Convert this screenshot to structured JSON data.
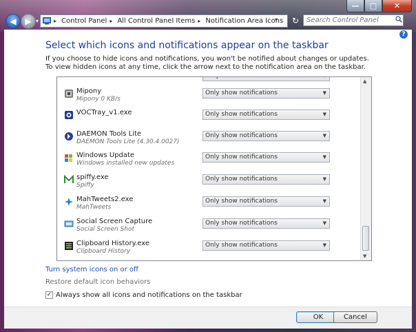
{
  "window": {
    "caption": {
      "minimize": "—",
      "maximize": "□",
      "close": "✕"
    }
  },
  "navigation": {
    "back_glyph": "◀",
    "forward_glyph": "▶",
    "history_dropdown": "▾",
    "breadcrumb": [
      "Control Panel",
      "All Control Panel Items",
      "Notification Area Icons"
    ],
    "breadcrumb_separator": "▸",
    "address_dropdown": "▾",
    "refresh_glyph": "↻",
    "search_placeholder": "Search Control Panel"
  },
  "help_glyph": "?",
  "heading": "Select which icons and notifications appear on the taskbar",
  "description": "If you choose to hide icons and notifications, you won't be notified about changes or updates. To view hidden icons at any time, click the arrow next to the notification area on the taskbar.",
  "icons": [
    {
      "name": "Mipony",
      "subtitle": "Mipony 0 KB/s",
      "behavior": "Only show notifications",
      "icon": "mipony-icon"
    },
    {
      "name": "VOCTray_v1.exe",
      "subtitle": "",
      "behavior": "Only show notifications",
      "icon": "voctray-icon"
    },
    {
      "name": "DAEMON Tools Lite",
      "subtitle": "DAEMON Tools Lite (4.30.4.0027)",
      "behavior": "Only show notifications",
      "icon": "daemon-tools-icon"
    },
    {
      "name": "Windows Update",
      "subtitle": "Windows installed new updates",
      "behavior": "Only show notifications",
      "icon": "windows-update-icon"
    },
    {
      "name": "spiffy.exe",
      "subtitle": "Spiffy",
      "behavior": "Only show notifications",
      "icon": "spiffy-icon"
    },
    {
      "name": "MahTweets2.exe",
      "subtitle": "MahTweets",
      "behavior": "Only show notifications",
      "icon": "mahtweets-icon"
    },
    {
      "name": "Social Screen Capture",
      "subtitle": "Social Screen Shot",
      "behavior": "Only show notifications",
      "icon": "social-screen-capture-icon"
    },
    {
      "name": "Clipboard History.exe",
      "subtitle": "Clipboard History",
      "behavior": "Only show notifications",
      "icon": "clipboard-history-icon"
    }
  ],
  "scrollbar": {
    "up": "▲",
    "down": "▼"
  },
  "links": {
    "system_icons": "Turn system icons on or off",
    "restore_defaults": "Restore default icon behaviors"
  },
  "always_show": {
    "label": "Always show all icons and notifications on the taskbar",
    "checked": true,
    "check_glyph": "✓"
  },
  "buttons": {
    "ok": "OK",
    "cancel": "Cancel"
  },
  "colors": {
    "heading": "#1a3fa3",
    "link": "#1a4fb0",
    "accent": "#2a64b8"
  }
}
